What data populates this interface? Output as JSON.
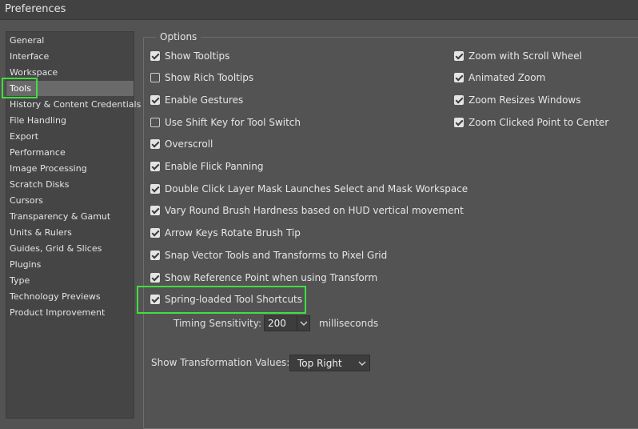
{
  "window": {
    "title": "Preferences"
  },
  "sidebar": {
    "items": [
      {
        "label": "General"
      },
      {
        "label": "Interface"
      },
      {
        "label": "Workspace"
      },
      {
        "label": "Tools",
        "selected": true
      },
      {
        "label": "History & Content Credentials"
      },
      {
        "label": "File Handling"
      },
      {
        "label": "Export"
      },
      {
        "label": "Performance"
      },
      {
        "label": "Image Processing"
      },
      {
        "label": "Scratch Disks"
      },
      {
        "label": "Cursors"
      },
      {
        "label": "Transparency & Gamut"
      },
      {
        "label": "Units & Rulers"
      },
      {
        "label": "Guides, Grid & Slices"
      },
      {
        "label": "Plugins"
      },
      {
        "label": "Type"
      },
      {
        "label": "Technology Previews"
      },
      {
        "label": "Product Improvement"
      }
    ]
  },
  "options": {
    "title": "Options",
    "left": [
      {
        "label": "Show Tooltips",
        "checked": true
      },
      {
        "label": "Show Rich Tooltips",
        "checked": false
      },
      {
        "label": "Enable Gestures",
        "checked": true
      },
      {
        "label": "Use Shift Key for Tool Switch",
        "checked": false
      },
      {
        "label": "Overscroll",
        "checked": true
      },
      {
        "label": "Enable Flick Panning",
        "checked": true
      },
      {
        "label": "Double Click Layer Mask Launches Select and Mask Workspace",
        "checked": true
      },
      {
        "label": "Vary Round Brush Hardness based on HUD vertical movement",
        "checked": true
      },
      {
        "label": "Arrow Keys Rotate Brush Tip",
        "checked": true
      },
      {
        "label": "Snap Vector Tools and Transforms to Pixel Grid",
        "checked": true
      },
      {
        "label": "Show Reference Point when using Transform",
        "checked": true
      },
      {
        "label": "Spring-loaded Tool Shortcuts",
        "checked": true
      }
    ],
    "right": [
      {
        "label": "Zoom with Scroll Wheel",
        "checked": true
      },
      {
        "label": "Animated Zoom",
        "checked": true
      },
      {
        "label": "Zoom Resizes Windows",
        "checked": true
      },
      {
        "label": "Zoom Clicked Point to Center",
        "checked": true
      }
    ],
    "timing": {
      "label": "Timing Sensitivity:",
      "value": "200",
      "unit": "milliseconds"
    },
    "transform": {
      "label": "Show Transformation Values:",
      "value": "Top Right"
    }
  },
  "colors": {
    "highlight": "#3ee03e",
    "selected_bg": "#6a6a6a",
    "panel_bg": "#535353"
  }
}
